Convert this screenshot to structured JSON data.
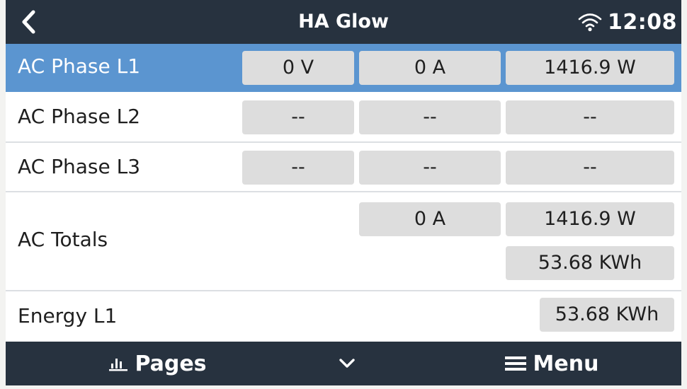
{
  "header": {
    "title": "HA Glow",
    "time": "12:08",
    "back_icon": "chevron-left-icon",
    "wifi_icon": "wifi-icon"
  },
  "rows": [
    {
      "label": "AC Phase L1",
      "voltage": "0 V",
      "current": "0 A",
      "power": "1416.9 W",
      "selected": true
    },
    {
      "label": "AC Phase L2",
      "voltage": "--",
      "current": "--",
      "power": "--",
      "selected": false
    },
    {
      "label": "AC Phase L3",
      "voltage": "--",
      "current": "--",
      "power": "--",
      "selected": false
    }
  ],
  "totals": {
    "label": "AC Totals",
    "current": "0 A",
    "power": "1416.9 W",
    "energy": "53.68 KWh"
  },
  "energy_l1": {
    "label": "Energy L1",
    "value": "53.68 KWh"
  },
  "footer": {
    "pages_label": "Pages",
    "pages_icon": "bar-chart-icon",
    "down_icon": "chevron-down-icon",
    "menu_label": "Menu",
    "menu_icon": "hamburger-icon"
  },
  "colors": {
    "bar": "#27323f",
    "selected": "#5b95d0",
    "cell": "#dddddd"
  }
}
